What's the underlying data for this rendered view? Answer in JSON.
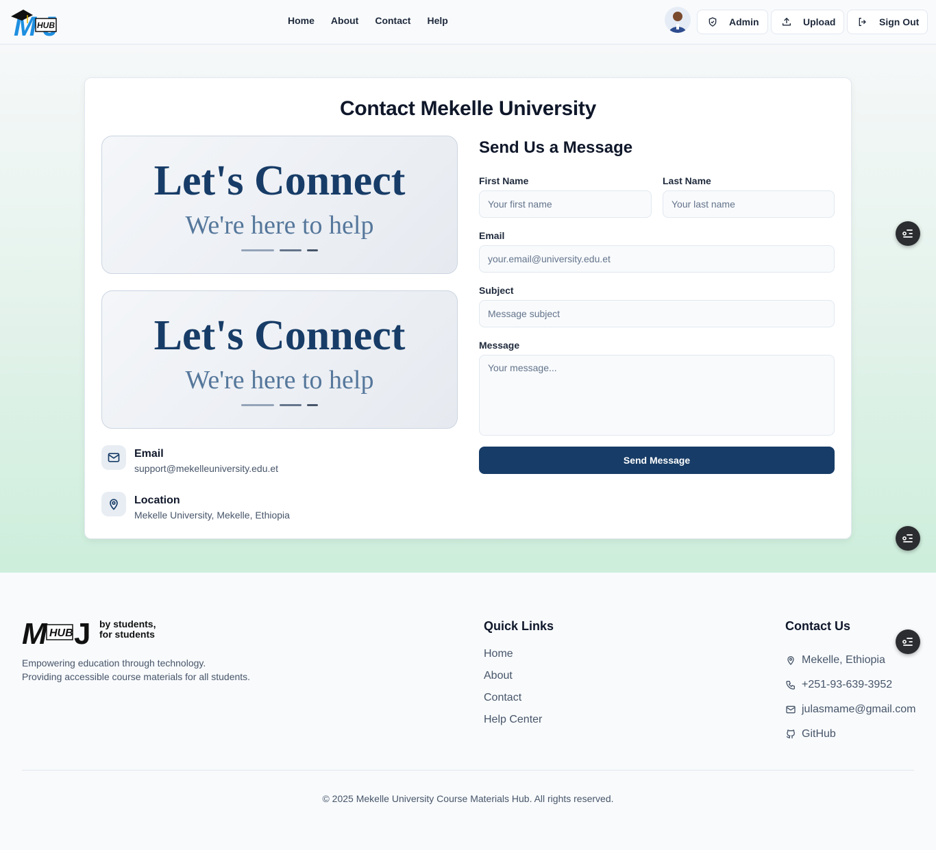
{
  "header": {
    "logo_text": "HUB",
    "nav": [
      "Home",
      "About",
      "Contact",
      "Help"
    ],
    "buttons": {
      "admin": "Admin",
      "upload": "Upload",
      "signout": "Sign Out"
    }
  },
  "card": {
    "title": "Contact Mekelle University",
    "banner": {
      "headline": "Let's Connect",
      "subline": "We're here to help"
    },
    "info": [
      {
        "label": "Email",
        "value": "support@mekelleuniversity.edu.et",
        "icon": "mail-icon"
      },
      {
        "label": "Location",
        "value": "Mekelle University, Mekelle, Ethiopia",
        "icon": "map-pin-icon"
      }
    ],
    "form": {
      "title": "Send Us a Message",
      "first_name_label": "First Name",
      "first_name_placeholder": "Your first name",
      "last_name_label": "Last Name",
      "last_name_placeholder": "Your last name",
      "email_label": "Email",
      "email_placeholder": "your.email@university.edu.et",
      "subject_label": "Subject",
      "subject_placeholder": "Message subject",
      "message_label": "Message",
      "message_placeholder": "Your message...",
      "submit": "Send Message"
    }
  },
  "footer": {
    "logo_text": "HUB",
    "tagline_1": "by students,",
    "tagline_2": "for students",
    "desc_1": "Empowering education through technology.",
    "desc_2": "Providing accessible course materials for all students.",
    "quick_links_title": "Quick Links",
    "quick_links": [
      "Home",
      "About",
      "Contact",
      "Help Center"
    ],
    "contact_title": "Contact Us",
    "contact": {
      "location": "Mekelle, Ethiopia",
      "phone": "+251-93-639-3952",
      "email": "julasmame@gmail.com",
      "github": "GitHub"
    },
    "copyright": "© 2025 Mekelle University Course Materials Hub. All rights reserved."
  },
  "colors": {
    "primary": "#173c67",
    "accent_blue": "#1e8fe0",
    "fab": "#2b2d31"
  }
}
